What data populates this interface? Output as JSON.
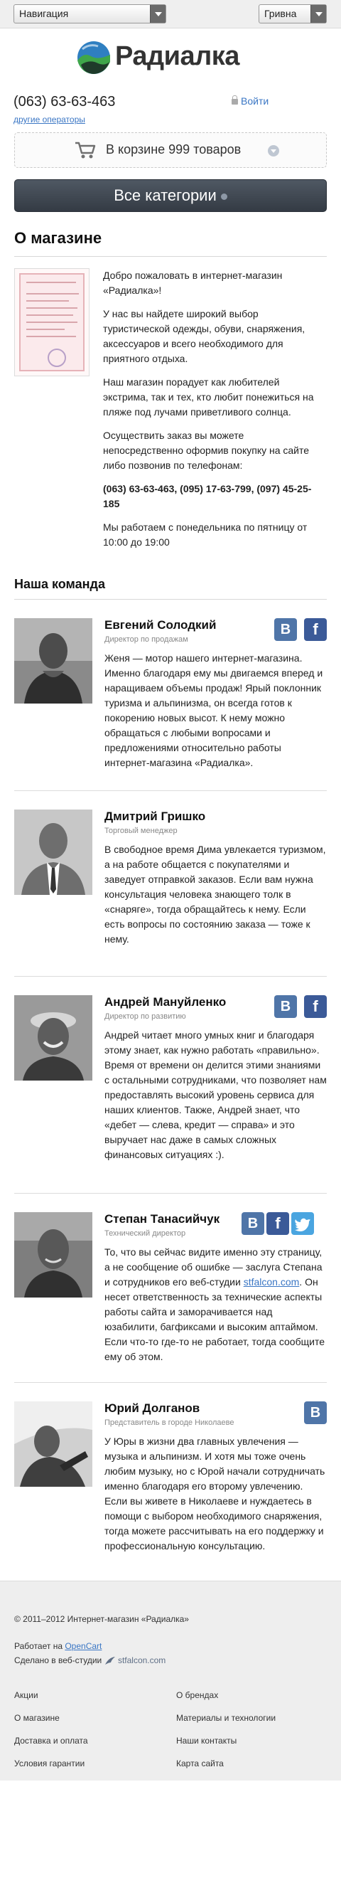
{
  "topbar": {
    "nav_select": "Навигация",
    "currency_select": "Гривна"
  },
  "logo": {
    "text": "Радиалка"
  },
  "contacts": {
    "phone": "(063) 63-63-463",
    "other_operators": "другие операторы",
    "login": "Войти"
  },
  "cart": {
    "text": "В корзине 999 товаров"
  },
  "categories_button": "Все категории",
  "about": {
    "title": "О магазине",
    "paragraphs": [
      "Добро пожаловать в интернет-магазин «Радиалка»!",
      "У нас вы найдете широкий выбор туристической одежды, обуви, снаряжения, аксессуаров и всего необходимого для приятного отдыха.",
      "Наш магазин порадует как любителей экстрима, так и тех, кто любит понежиться на пляже под лучами приветливого солнца.",
      "Осуществить заказ вы можете непосредственно оформив покупку на сайте либо позвонив по телефонам:",
      "(063) 63-63-463, (095) 17-63-799, (097) 45-25-185",
      "Мы работаем с понедельника по пятницу от 10:00 до 19:00"
    ]
  },
  "team": {
    "title": "Наша команда",
    "members": [
      {
        "name": "Евгений Солодкий",
        "role": "Директор по продажам",
        "bio": "Женя — мотор нашего интернет-магазина. Именно благодаря ему мы двигаемся вперед и наращиваем объемы продаж! Ярый поклонник туризма и альпинизма, он всегда готов к покорению новых высот. К нему можно обращаться с любыми вопросами и предложениями относительно работы интернет-магазина «Радиалка»."
      },
      {
        "name": "Дмитрий Гришко",
        "role": "Торговый менеджер",
        "bio": "В свободное время Дима увлекается туризмом, а на работе общается с покупателями и заведует отправкой заказов. Если вам нужна консультация человека знающего толк в «снаряге», тогда обращайтесь к нему. Если есть вопросы по состоянию заказа — тоже к нему."
      },
      {
        "name": "Андрей Мануйленко",
        "role": "Директор по развитию",
        "bio": "Андрей читает много умных книг и благодаря этому знает, как нужно работать «правильно». Время от времени он делится этими знаниями с остальными сотрудниками, что позволяет нам предоставлять высокий уровень сервиса для наших клиентов. Также, Андрей знает, что «дебет — слева, кредит — справа» и это выручает нас даже в самых сложных финансовых ситуациях :)."
      },
      {
        "name": "Степан Танасийчук",
        "role": "Технический директор",
        "bio_before": "То, что вы сейчас видите именно эту страницу, а не сообщение об ошибке — заслуга Степана и сотрудников его веб-студии ",
        "bio_link": "stfalcon.com",
        "bio_after": ". Он несет ответственность за технические аспекты работы сайта и заморачивается над юзабилити, багфиксами и высоким аптаймом. Если что-то где-то не работает, тогда сообщите ему об этом."
      },
      {
        "name": "Юрий Долганов",
        "role": "Представитель в городе Николаеве",
        "bio": "У Юры в жизни два главных увлечения — музыка и альпинизм. И хотя мы тоже очень любим музыку, но с Юрой начали сотрудничать именно благодаря его второму увлечению. Если вы живете в Николаеве и нуждаетесь в помощи с выбором необходимого снаряжения, тогда можете рассчитывать на его поддержку и профессиональную консультацию."
      }
    ]
  },
  "social": {
    "vk": "В",
    "fb": "f"
  },
  "footer": {
    "copyright": "© 2011–2012 Интернет-магазин «Радиалка»",
    "powered_prefix": "Работает на ",
    "powered_link": "OpenCart",
    "studio_prefix": "Сделано в веб-студии ",
    "studio_logo": "stfalcon.com",
    "links_left": [
      "Акции",
      "О магазине",
      "Доставка и оплата",
      "Условия гарантии"
    ],
    "links_right": [
      "О брендах",
      "Материалы и технологии",
      "Наши контакты",
      "Карта сайта"
    ]
  }
}
